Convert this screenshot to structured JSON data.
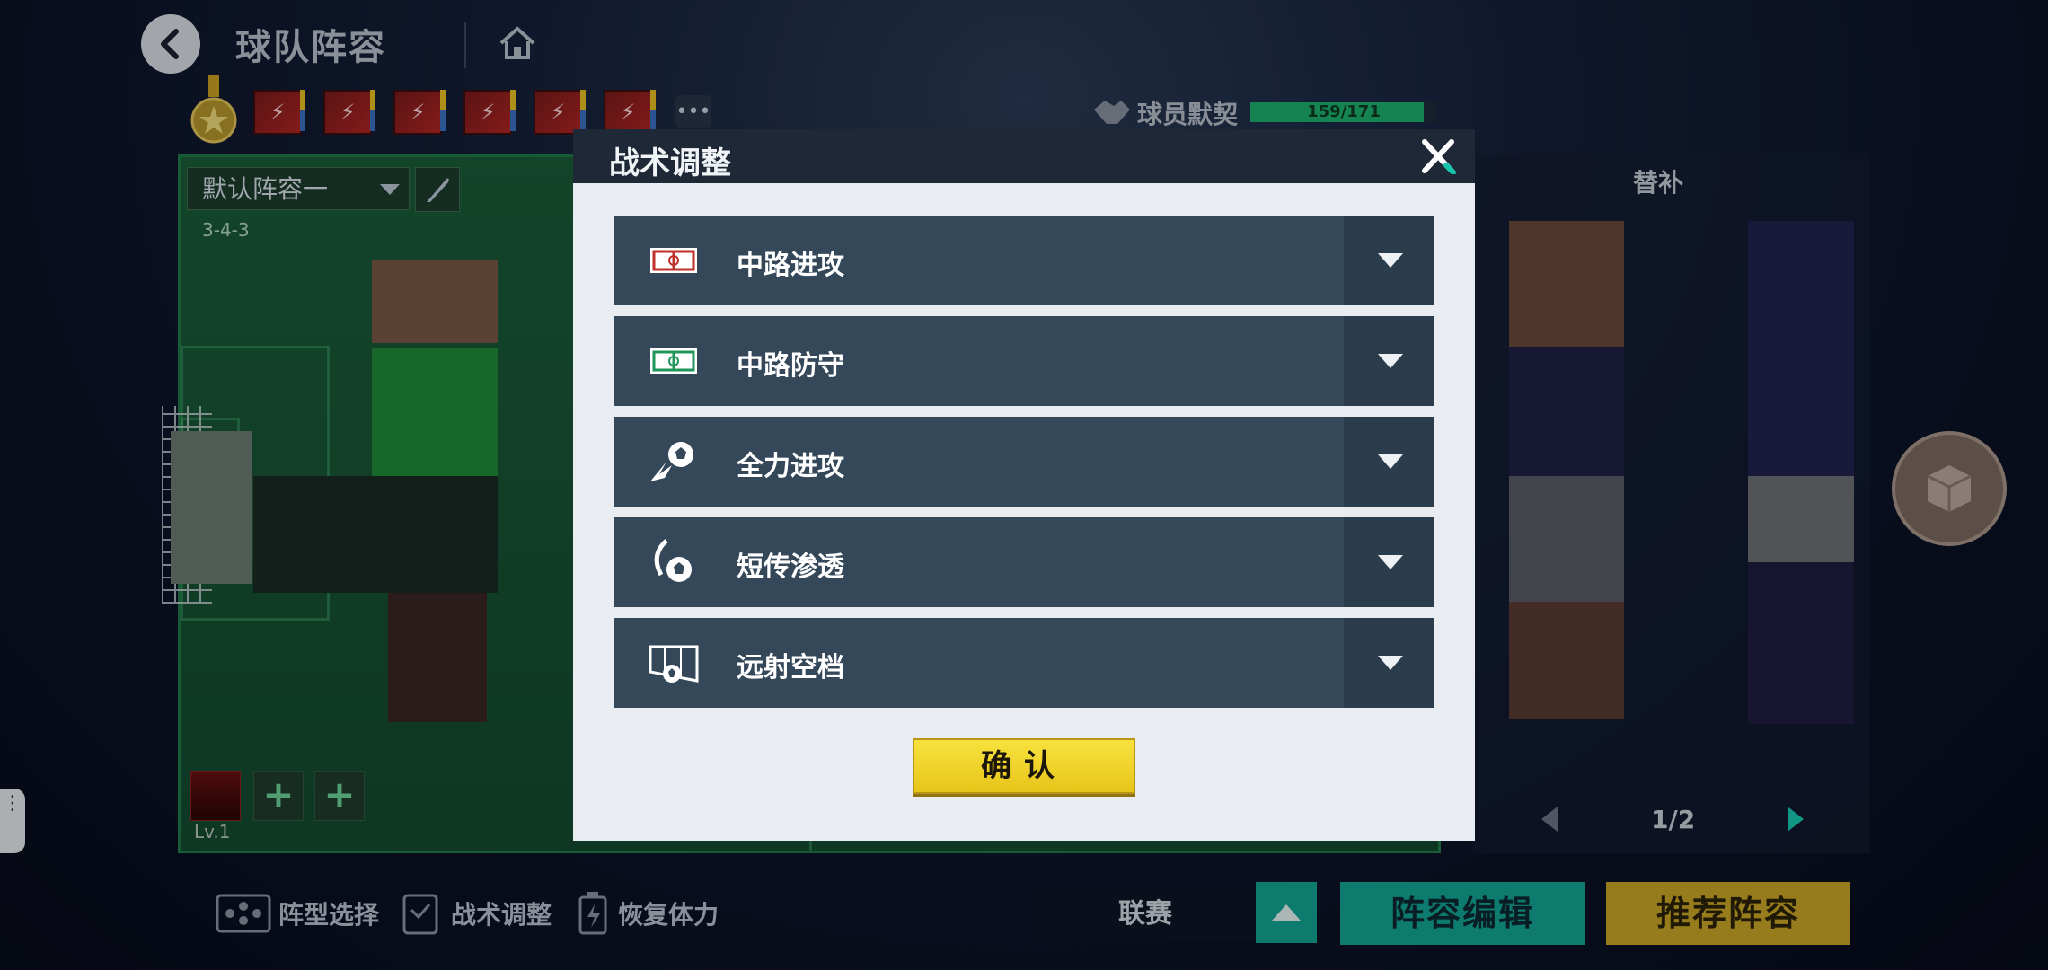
{
  "header": {
    "title": "球队阵容"
  },
  "chemistry": {
    "label": "球员默契",
    "value_text": "159/171",
    "current": 159,
    "max": 171
  },
  "lineup": {
    "selected": "默认阵容一",
    "formation": "3-4-3"
  },
  "substitutes": {
    "level_text": "Lv.1",
    "add_symbol": "+"
  },
  "bench": {
    "title": "替补",
    "page_text": "1/2"
  },
  "bottom_bar": {
    "formation_select": "阵型选择",
    "tactics_adjust": "战术调整",
    "restore_stamina": "恢复体力",
    "league": "联赛",
    "edit_lineup": "阵容编辑",
    "recommended_lineup": "推荐阵容"
  },
  "dialog": {
    "title": "战术调整",
    "tactics": [
      {
        "label": "中路进攻",
        "icon": "pitch-attack-icon"
      },
      {
        "label": "中路防守",
        "icon": "pitch-defense-icon"
      },
      {
        "label": "全力进攻",
        "icon": "fireball-icon"
      },
      {
        "label": "短传渗透",
        "icon": "short-pass-icon"
      },
      {
        "label": "远射空档",
        "icon": "long-shot-icon"
      }
    ],
    "confirm": "确认"
  },
  "colors": {
    "accent_teal": "#13a495",
    "accent_gold": "#c8a627",
    "chem_green": "#1db06e",
    "row_bg": "#35485a"
  }
}
